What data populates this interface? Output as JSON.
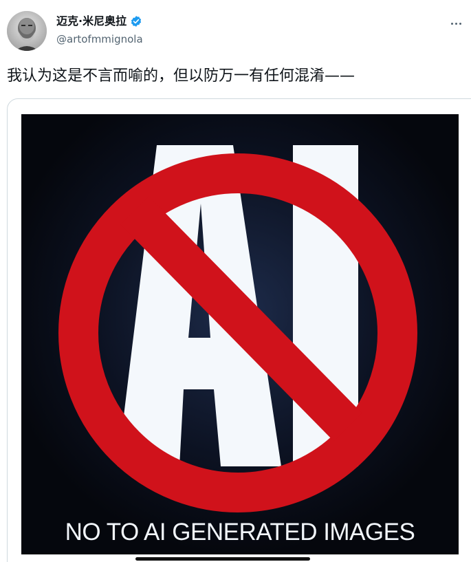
{
  "author": {
    "display_name": "迈克·米尼奥拉",
    "handle": "@artofmmignola",
    "verified": true
  },
  "post": {
    "text": "我认为这是不言而喻的，但以防万一有任何混淆——"
  },
  "media": {
    "symbol_letters": "AI",
    "caption": "NO TO AI GENERATED IMAGES"
  },
  "icons": {
    "verified": "verified-badge-icon",
    "more": "more-options-icon",
    "avatar": "author-avatar"
  },
  "colors": {
    "prohibition_red": "#d0121b",
    "letters": "#f4f8fc",
    "image_background": "#070a12",
    "verified_blue": "#1d9bf0",
    "handle_gray": "#536471"
  }
}
